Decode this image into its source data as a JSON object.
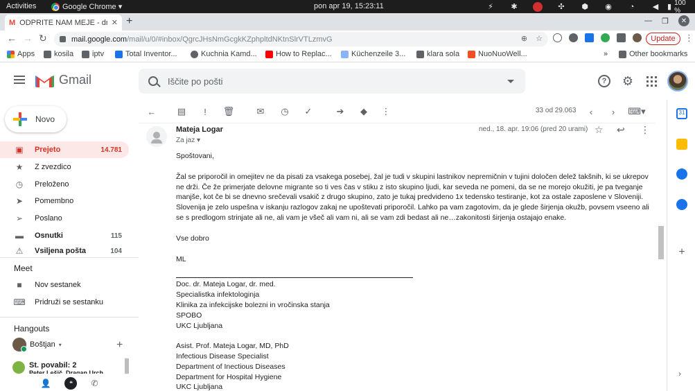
{
  "system_bar": {
    "activities": "Activities",
    "app": "Google Chrome ▾",
    "clock": "pon apr 19, 15:23:11",
    "battery": "100 %"
  },
  "browser": {
    "tab_title": "ODPRITE NAM MEJE - dr",
    "new_tab": "+",
    "url_host": "mail.google.com",
    "url_path": "/mail/u/0/#inbox/QgrcJHsNmGcgkKZphpltdNKtnSlrVTLzmvG",
    "update_label": "Update",
    "bookmarks": [
      {
        "label": "Apps"
      },
      {
        "label": "kosila"
      },
      {
        "label": "iptv"
      },
      {
        "label": "Total Inventor..."
      },
      {
        "label": "Kuchnia Kamd..."
      },
      {
        "label": "How to Replac..."
      },
      {
        "label": "Küchenzeile 3..."
      },
      {
        "label": "klara sola"
      },
      {
        "label": "NuoNuoWell..."
      }
    ],
    "bookmarks_more": "»",
    "other_bookmarks": "Other bookmarks"
  },
  "gmail": {
    "logo_text": "Gmail",
    "search_placeholder": "Iščite po pošti",
    "compose_label": "Novo",
    "nav": [
      {
        "label": "Prejeto",
        "count": "14.781"
      },
      {
        "label": "Z zvezdico",
        "count": ""
      },
      {
        "label": "Preloženo",
        "count": ""
      },
      {
        "label": "Pomembno",
        "count": ""
      },
      {
        "label": "Poslano",
        "count": ""
      },
      {
        "label": "Osnutki",
        "count": "115"
      },
      {
        "label": "Vsiljena pošta",
        "count": "104"
      }
    ],
    "meet": {
      "title": "Meet",
      "new_meeting": "Nov sestanek",
      "join_meeting": "Pridruži se sestanku"
    },
    "hangouts": {
      "title": "Hangouts",
      "user": "Boštjan",
      "chat_title": "St. povabil: 2",
      "chat_sub": "Peter Lešič, Dragan Urch"
    },
    "pager": "33 od 29.063"
  },
  "message": {
    "sender": "Mateja Logar",
    "to": "Za jaz",
    "date": "ned., 18. apr. 19:06 (pred 20 urami)",
    "greeting": "Spoštovani,",
    "para1": "Žal se priporočil in omejitev ne da pisati za vsakega posebej, žal je tudi v skupini lastnikov nepremičnin v tujini določen delež takšnih, ki se ukrepov ne drži. Če že primerjate delovne migrante so ti ves čas v stiku z isto skupino ljudi, kar seveda ne pomeni, da se ne morejo okužiti, je pa tveganje manjše, kot če bi se dnevno srečevali vsakič z drugo skupino, zato je tukaj predvideno 1x tedensko testiranje, kot za ostale zaposlene v Sloveniji.",
    "para2": "Slovenija je zelo uspešna v iskanju razlogov zakaj ne upoštevati priporočil. Lahko pa vam zagotovim, da je glede širjenja okužb, povsem vseeno ali se s predlogom strinjate ali ne, ali vam je všeč ali vam ni, ali se vam zdi bedast ali ne…zakonitosti širjenja ostajajo enake.",
    "closing": "Vse dobro",
    "initials": "ML",
    "sig1": [
      "Doc. dr. Mateja Logar, dr. med.",
      "Specialistka infektologinja",
      "Klinika za infekcijske bolezni in vročinska stanja",
      "SPOBO",
      "UKC Ljubljana"
    ],
    "sig2": [
      "Asist. Prof. Mateja Logar, MD, PhD",
      "Infectious Disease Specialist",
      "Department of Inectious Diseases",
      "Department for Hospital Hygiene",
      "UKC Ljubljana"
    ]
  }
}
